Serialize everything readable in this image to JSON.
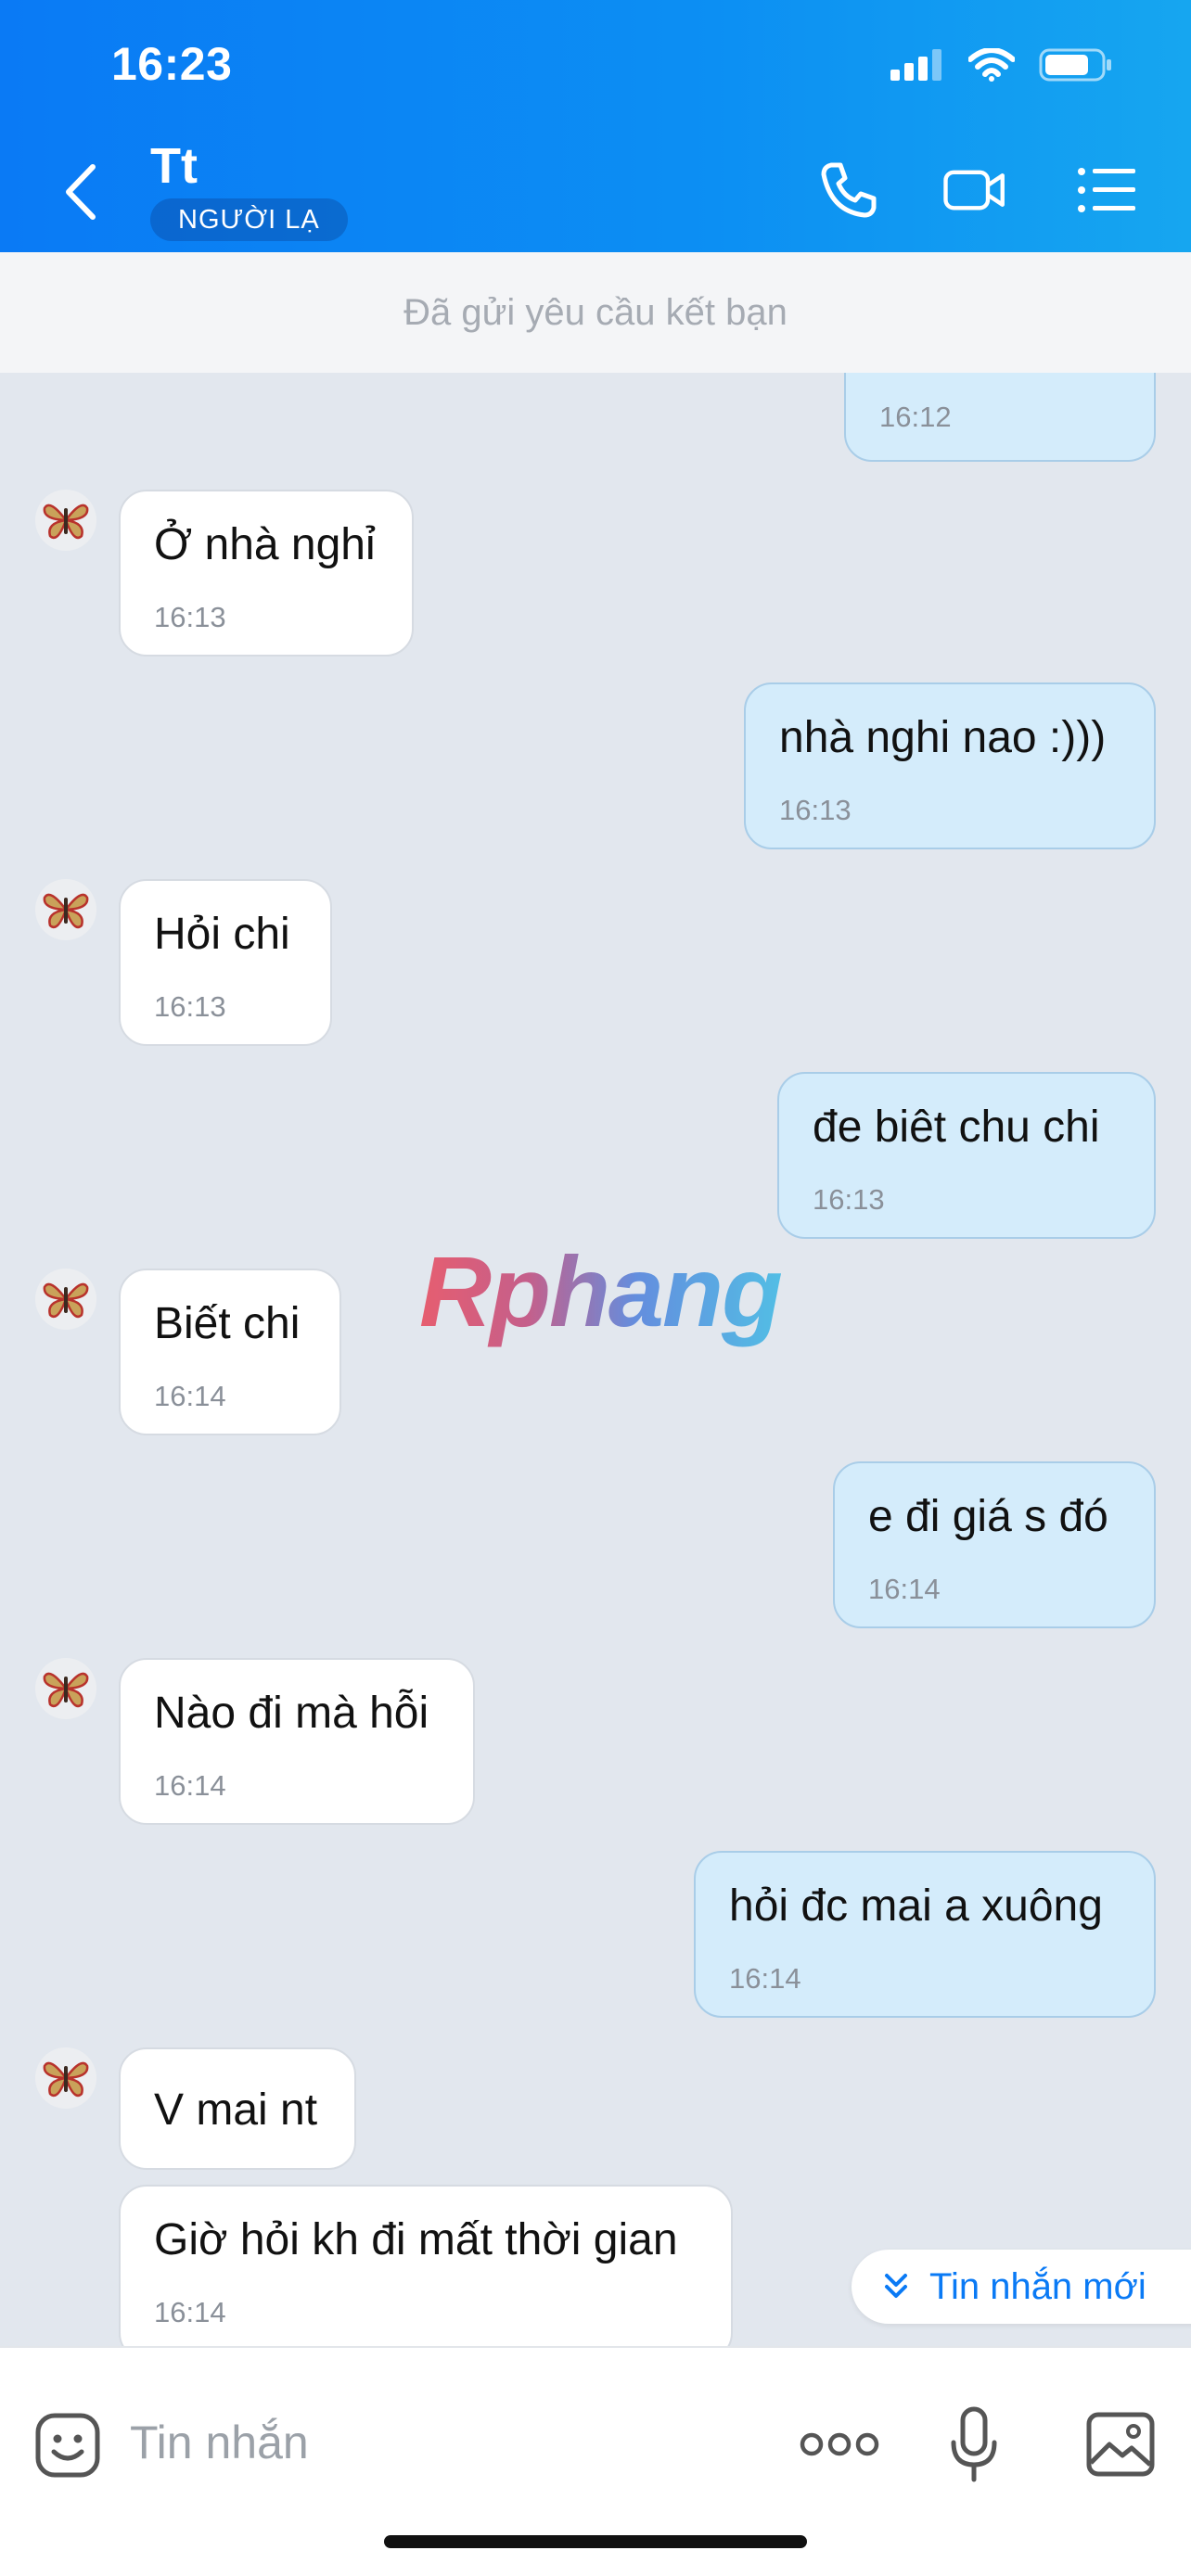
{
  "status": {
    "time": "16:23"
  },
  "header": {
    "title": "Tt",
    "badge": "NGƯỜI LẠ"
  },
  "friend_request": "Đã gửi yêu cầu kết bạn",
  "messages": [
    {
      "dir": "out",
      "text": "",
      "time": "16:12"
    },
    {
      "dir": "in",
      "text": "Ở nhà nghỉ",
      "time": "16:13"
    },
    {
      "dir": "out",
      "text": "nhà nghi nao :)))",
      "time": "16:13"
    },
    {
      "dir": "in",
      "text": "Hỏi chi",
      "time": "16:13"
    },
    {
      "dir": "out",
      "text": "đe biêt chu chi",
      "time": "16:13"
    },
    {
      "dir": "in",
      "text": "Biết chi",
      "time": "16:14"
    },
    {
      "dir": "out",
      "text": "e đi giá s đó",
      "time": "16:14"
    },
    {
      "dir": "in",
      "text": "Nào đi mà hỗi",
      "time": "16:14"
    },
    {
      "dir": "out",
      "text": "hỏi đc mai a xuông",
      "time": "16:14"
    },
    {
      "dir": "in",
      "text": "V mai nt",
      "time": ""
    },
    {
      "dir": "in",
      "text": "Giờ hỏi kh đi mất thời gian",
      "time": "16:14"
    }
  ],
  "watermark": "Rphang",
  "new_message_label": "Tin nhắn mới",
  "composer": {
    "placeholder": "Tin nhắn"
  },
  "colors": {
    "header_start": "#0a7af5",
    "header_end": "#16a6f0",
    "bubble_out": "#d4ecfb",
    "bubble_in": "#ffffff",
    "accent": "#0a7af5"
  },
  "icons": [
    "back-icon",
    "phone-icon",
    "video-call-icon",
    "menu-list-icon",
    "sticker-icon",
    "more-icon",
    "microphone-icon",
    "image-icon",
    "double-chevron-down-icon"
  ]
}
